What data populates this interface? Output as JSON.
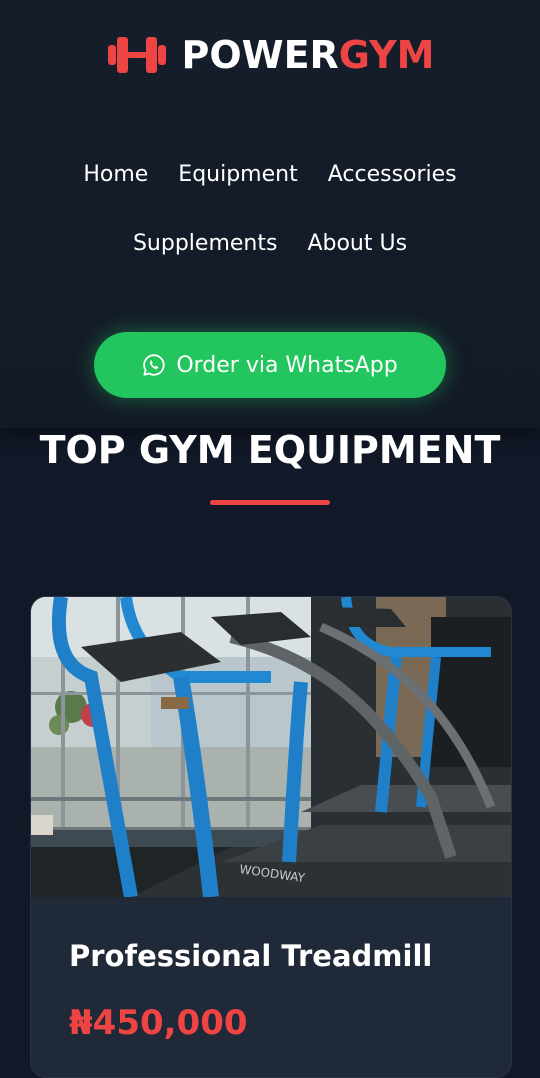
{
  "brand": {
    "name_part1": "POWER",
    "name_part2": "GYM",
    "icon": "dumbbell-icon",
    "accent_color": "#ef4444"
  },
  "nav": {
    "items": [
      {
        "label": "Home"
      },
      {
        "label": "Equipment"
      },
      {
        "label": "Accessories"
      },
      {
        "label": "Supplements"
      },
      {
        "label": "About Us"
      }
    ]
  },
  "cta": {
    "label": "Order via WhatsApp",
    "icon": "whatsapp-icon",
    "color": "#22c55e"
  },
  "section": {
    "title": "TOP GYM EQUIPMENT"
  },
  "products": [
    {
      "name": "Professional Treadmill",
      "price": "₦450,000",
      "image": "treadmill-photo"
    }
  ],
  "colors": {
    "background": "#111827",
    "card": "#1f2937",
    "price": "#ef4444"
  }
}
